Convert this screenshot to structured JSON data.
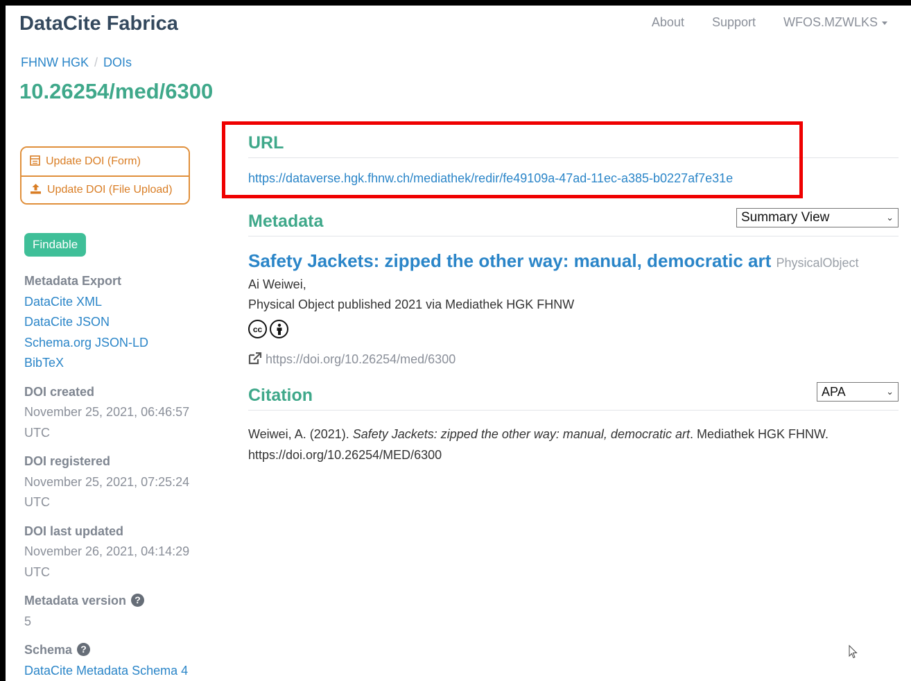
{
  "app": {
    "brand": "DataCite Fabrica",
    "nav": {
      "about": "About",
      "support": "Support",
      "user": "WFOS.MZWLKS"
    }
  },
  "breadcrumb": {
    "parent": "FHNW HGK",
    "separator": "/",
    "current": "DOIs"
  },
  "doi": "10.26254/med/6300",
  "actions": {
    "update_form": "Update DOI (Form)",
    "update_file": "Update DOI (File Upload)"
  },
  "state_badge": "Findable",
  "sidebar": {
    "metadata_export_label": "Metadata Export",
    "exports": [
      "DataCite XML",
      "DataCite JSON",
      "Schema.org JSON-LD",
      "BibTeX"
    ],
    "doi_created_label": "DOI created",
    "doi_created_value_1": "November 25, 2021, 06:46:57",
    "doi_created_value_2": "UTC",
    "doi_registered_label": "DOI registered",
    "doi_registered_value_1": "November 25, 2021, 07:25:24",
    "doi_registered_value_2": "UTC",
    "doi_updated_label": "DOI last updated",
    "doi_updated_value_1": "November 26, 2021, 04:14:29",
    "doi_updated_value_2": "UTC",
    "metadata_version_label": "Metadata version",
    "metadata_version_value": "5",
    "schema_label": "Schema",
    "schema_value": "DataCite Metadata Schema 4"
  },
  "url_section": {
    "heading": "URL",
    "link": "https://dataverse.hgk.fhnw.ch/mediathek/redir/fe49109a-47ad-11ec-a385-b0227af7e31e"
  },
  "metadata_section": {
    "heading": "Metadata",
    "view_select": "Summary View",
    "title": "Safety Jackets: zipped the other way: manual, democratic art",
    "resource_type": "PhysicalObject",
    "creator": "Ai Weiwei,",
    "published": "Physical Object published 2021 via Mediathek HGK FHNW",
    "license_icons": [
      "cc-icon",
      "by-icon"
    ],
    "doi_url": "https://doi.org/10.26254/med/6300"
  },
  "citation_section": {
    "heading": "Citation",
    "style_select": "APA",
    "prefix": "Weiwei, A. (2021). ",
    "title": "Safety Jackets: zipped the other way: manual, democratic art",
    "suffix": ". Mediathek HGK FHNW.",
    "url": "https://doi.org/10.26254/MED/6300"
  },
  "colors": {
    "accent_green": "#3fa88a",
    "badge_green": "#3fbf98",
    "link_blue": "#2a85c8",
    "orange": "#e08f3a",
    "highlight_red": "#ef0000"
  }
}
